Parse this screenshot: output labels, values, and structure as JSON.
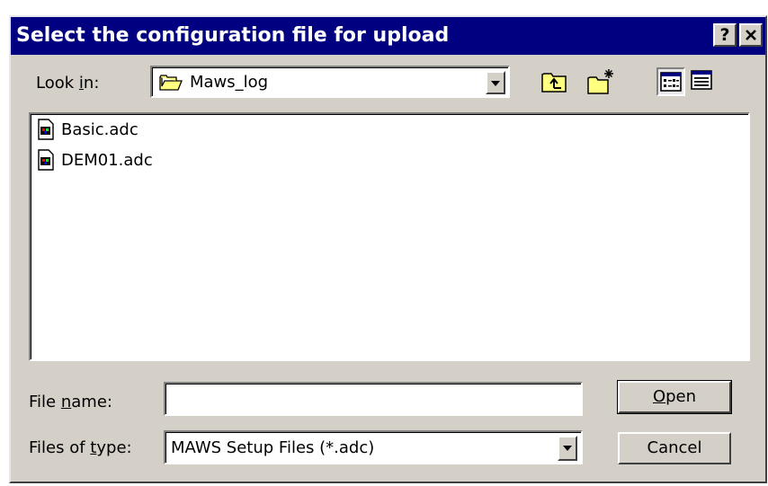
{
  "window": {
    "title": "Select the configuration file for upload",
    "help_button": "?",
    "close_button": "✕"
  },
  "look_in": {
    "label_before": "Look ",
    "label_accel": "i",
    "label_after": "n:",
    "value": "Maws_log"
  },
  "toolbar": {
    "icons": [
      "up-one-level-icon",
      "create-new-folder-icon",
      "list-view-icon",
      "details-view-icon"
    ],
    "active_view": "list-view"
  },
  "files": [
    {
      "name": "Basic.adc",
      "icon": "adc-file-icon"
    },
    {
      "name": "DEM01.adc",
      "icon": "adc-file-icon"
    }
  ],
  "file_name": {
    "label_before": "File ",
    "label_accel": "n",
    "label_after": "ame:",
    "value": ""
  },
  "file_type": {
    "label_before": "Files of ",
    "label_accel": "t",
    "label_after": "ype:",
    "value": "MAWS Setup Files (*.adc)"
  },
  "buttons": {
    "open_accel": "O",
    "open_rest": "pen",
    "cancel": "Cancel"
  },
  "colors": {
    "title_bar": "#000080",
    "face": "#d4d0c8",
    "folder": "#ffff80"
  }
}
